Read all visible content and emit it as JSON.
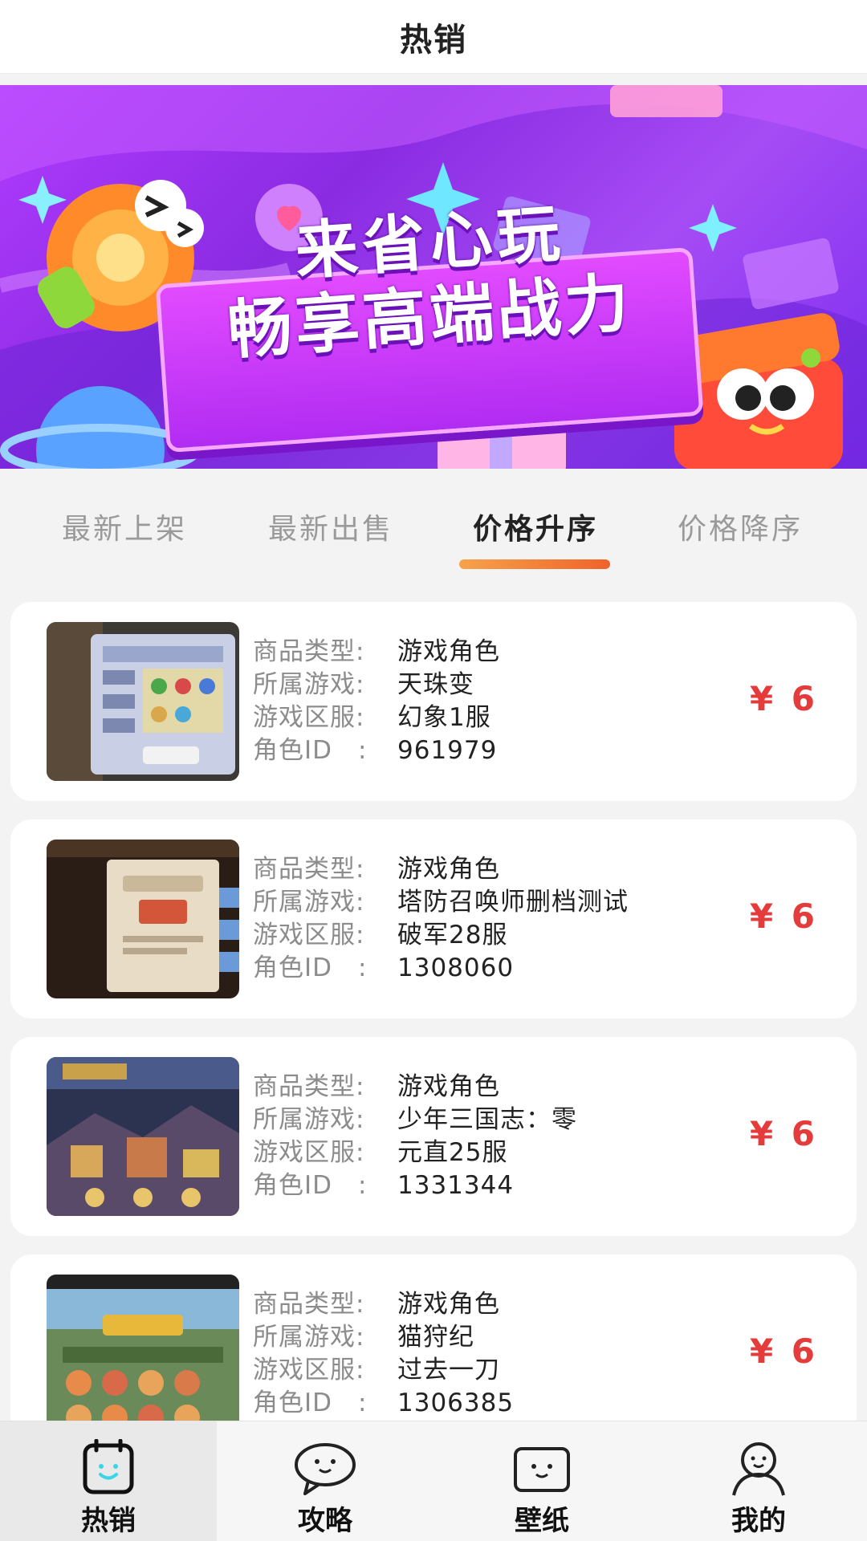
{
  "header": {
    "title": "热销"
  },
  "banner": {
    "line1": "来省心玩",
    "line2": "畅享高端战力"
  },
  "tabs": [
    {
      "label": "最新上架",
      "active": false
    },
    {
      "label": "最新出售",
      "active": false
    },
    {
      "label": "价格升序",
      "active": true
    },
    {
      "label": "价格降序",
      "active": false
    }
  ],
  "labels": {
    "type": "商品类型:",
    "game": "所属游戏:",
    "server": "游戏区服:",
    "role_id": "角色ID　:"
  },
  "products": [
    {
      "type": "游戏角色",
      "game": "天珠变",
      "server": "幻象1服",
      "role_id": "961979",
      "price": "¥ 6"
    },
    {
      "type": "游戏角色",
      "game": "塔防召唤师删档测试",
      "server": "破军28服",
      "role_id": "1308060",
      "price": "¥ 6"
    },
    {
      "type": "游戏角色",
      "game": "少年三国志：零",
      "server": "元直25服",
      "role_id": "1331344",
      "price": "¥ 6"
    },
    {
      "type": "游戏角色",
      "game": "猫狩纪",
      "server": "过去一刀",
      "role_id": "1306385",
      "price": "¥ 6"
    }
  ],
  "nav": [
    {
      "label": "热销",
      "icon": "calendar-face-icon",
      "active": true
    },
    {
      "label": "攻略",
      "icon": "chat-bubble-icon",
      "active": false
    },
    {
      "label": "壁纸",
      "icon": "tv-face-icon",
      "active": false
    },
    {
      "label": "我的",
      "icon": "user-icon",
      "active": false
    }
  ],
  "colors": {
    "price": "#e53b3b",
    "tab_underline": "#f0632a",
    "accent_icon": "#38d6e6"
  }
}
